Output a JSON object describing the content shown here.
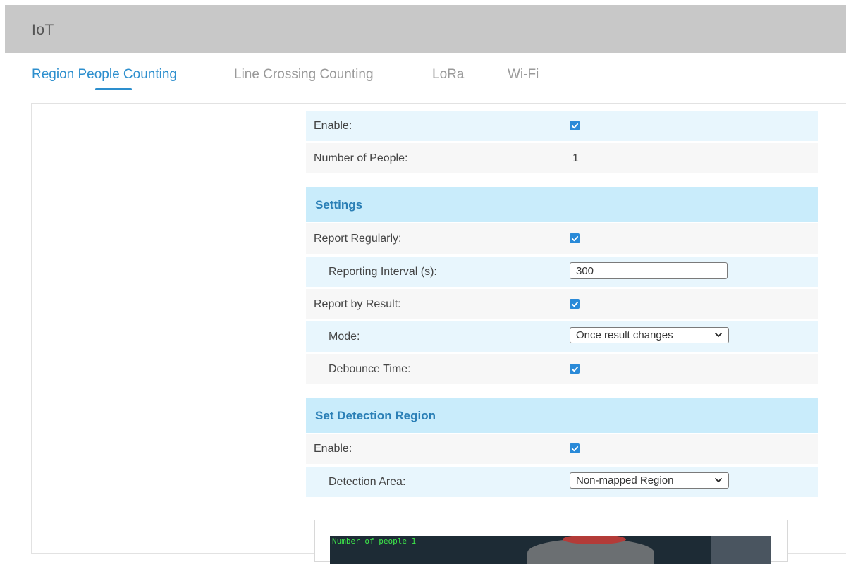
{
  "header": {
    "title": "IoT"
  },
  "tabs": [
    {
      "label": "Region People Counting",
      "active": true
    },
    {
      "label": "Line Crossing Counting",
      "active": false
    },
    {
      "label": "LoRa",
      "active": false
    },
    {
      "label": "Wi-Fi",
      "active": false
    }
  ],
  "status": {
    "enable_label": "Enable:",
    "enable_checked": true,
    "people_label": "Number of People:",
    "people_value": "1"
  },
  "settings": {
    "title": "Settings",
    "report_regularly_label": "Report Regularly:",
    "report_regularly_checked": true,
    "interval_label": "Reporting Interval (s):",
    "interval_value": "300",
    "report_by_result_label": "Report by Result:",
    "report_by_result_checked": true,
    "mode_label": "Mode:",
    "mode_value": "Once result changes",
    "debounce_label": "Debounce Time:",
    "debounce_checked": true
  },
  "detection": {
    "title": "Set Detection Region",
    "enable_label": "Enable:",
    "enable_checked": true,
    "area_label": "Detection Area:",
    "area_value": "Non-mapped Region"
  },
  "preview": {
    "osd_text": "Number of people 1"
  },
  "colors": {
    "accent": "#2d8fce",
    "section_bg": "#c9ecfb",
    "row_blue": "#e8f6fd",
    "checkbox": "#2a8ad8"
  }
}
